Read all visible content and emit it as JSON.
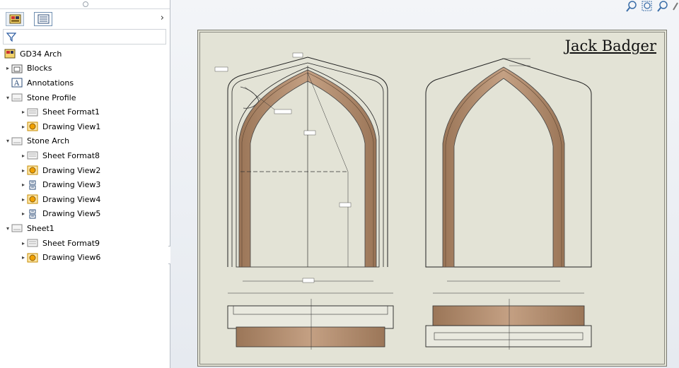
{
  "tree": {
    "root": {
      "label": "GD34 Arch"
    },
    "items": [
      {
        "label": "Blocks",
        "level": 1,
        "expander": "collapsed",
        "icon": "blocks-folder-icon"
      },
      {
        "label": "Annotations",
        "level": 1,
        "expander": "none",
        "icon": "annotations-icon"
      },
      {
        "label": "Stone Profile",
        "level": 1,
        "expander": "expanded",
        "icon": "sheet-icon"
      },
      {
        "label": "Sheet Format1",
        "level": 2,
        "expander": "collapsed",
        "icon": "sheet-format-icon"
      },
      {
        "label": "Drawing View1",
        "level": 2,
        "expander": "collapsed",
        "icon": "drawing-view-icon"
      },
      {
        "label": "Stone Arch",
        "level": 1,
        "expander": "expanded",
        "icon": "sheet-icon"
      },
      {
        "label": "Sheet Format8",
        "level": 2,
        "expander": "collapsed",
        "icon": "sheet-format-icon"
      },
      {
        "label": "Drawing View2",
        "level": 2,
        "expander": "collapsed",
        "icon": "drawing-view-icon"
      },
      {
        "label": "Drawing View3",
        "level": 2,
        "expander": "collapsed",
        "icon": "section-view-icon"
      },
      {
        "label": "Drawing View4",
        "level": 2,
        "expander": "collapsed",
        "icon": "drawing-view-icon"
      },
      {
        "label": "Drawing View5",
        "level": 2,
        "expander": "collapsed",
        "icon": "section-view-icon"
      },
      {
        "label": "Sheet1",
        "level": 1,
        "expander": "expanded",
        "icon": "sheet-icon"
      },
      {
        "label": "Sheet Format9",
        "level": 2,
        "expander": "collapsed",
        "icon": "sheet-format-icon"
      },
      {
        "label": "Drawing View6",
        "level": 2,
        "expander": "collapsed",
        "icon": "drawing-view-icon"
      }
    ]
  },
  "drawing": {
    "title": "Jack Badger"
  },
  "colors": {
    "stone": "#b38e6f",
    "stone_dark": "#8f6c52",
    "sheet": "#e3e3d6"
  }
}
